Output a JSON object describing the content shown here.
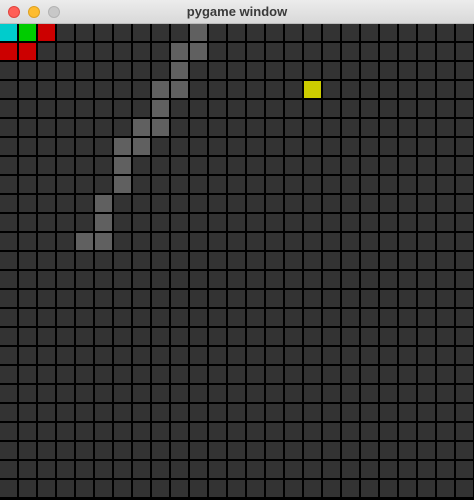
{
  "window": {
    "title": "pygame window"
  },
  "colors": {
    "empty": "#333333",
    "trail": "#606060",
    "food": "#cccc00",
    "head": "#00cccc",
    "body_green": "#00cc00",
    "body_red": "#cc0000"
  },
  "grid": {
    "columns": 25,
    "rows": 25,
    "colored_cells": [
      {
        "col": 0,
        "row": 0,
        "kind": "head"
      },
      {
        "col": 1,
        "row": 0,
        "kind": "body_green"
      },
      {
        "col": 2,
        "row": 0,
        "kind": "body_red"
      },
      {
        "col": 0,
        "row": 1,
        "kind": "body_red"
      },
      {
        "col": 1,
        "row": 1,
        "kind": "body_red"
      },
      {
        "col": 16,
        "row": 3,
        "kind": "food"
      },
      {
        "col": 10,
        "row": 0,
        "kind": "trail"
      },
      {
        "col": 9,
        "row": 1,
        "kind": "trail"
      },
      {
        "col": 10,
        "row": 1,
        "kind": "trail"
      },
      {
        "col": 9,
        "row": 2,
        "kind": "trail"
      },
      {
        "col": 8,
        "row": 3,
        "kind": "trail"
      },
      {
        "col": 9,
        "row": 3,
        "kind": "trail"
      },
      {
        "col": 8,
        "row": 4,
        "kind": "trail"
      },
      {
        "col": 7,
        "row": 5,
        "kind": "trail"
      },
      {
        "col": 8,
        "row": 5,
        "kind": "trail"
      },
      {
        "col": 6,
        "row": 6,
        "kind": "trail"
      },
      {
        "col": 7,
        "row": 6,
        "kind": "trail"
      },
      {
        "col": 6,
        "row": 7,
        "kind": "trail"
      },
      {
        "col": 6,
        "row": 8,
        "kind": "trail"
      },
      {
        "col": 5,
        "row": 9,
        "kind": "trail"
      },
      {
        "col": 5,
        "row": 10,
        "kind": "trail"
      },
      {
        "col": 4,
        "row": 11,
        "kind": "trail"
      },
      {
        "col": 5,
        "row": 11,
        "kind": "trail"
      }
    ]
  }
}
